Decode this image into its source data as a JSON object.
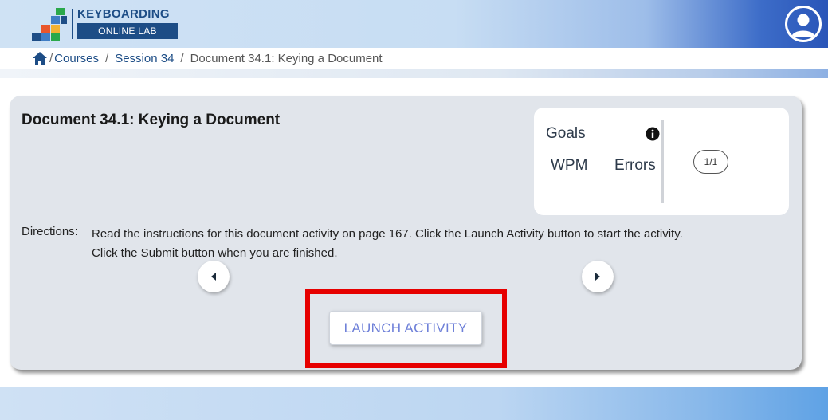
{
  "header": {
    "logo_top": "KEYBOARDING",
    "logo_bottom": "ONLINE LAB",
    "logo_block_colors": [
      "#1d4d86",
      "#3e7dc4",
      "#2aa84a",
      "#e8562a",
      "#f2b233"
    ]
  },
  "breadcrumb": {
    "home_icon": "home-icon",
    "courses": "Courses",
    "session": "Session 34",
    "current": "Document 34.1: Keying a Document",
    "separator": "/"
  },
  "card": {
    "title": "Document 34.1: Keying a Document",
    "goals": {
      "title": "Goals",
      "wpm_label": "WPM",
      "errors_label": "Errors",
      "pager": "1/1"
    },
    "directions_label": "Directions:",
    "directions_text": "Read the instructions for this document activity on page 167. Click the Launch Activity button to start the activity. Click the Submit button when you are finished.",
    "launch_label": "LAUNCH ACTIVITY"
  },
  "colors": {
    "brand": "#1d4d86",
    "highlight": "#e60000",
    "launch_text": "#6d7fd8"
  }
}
